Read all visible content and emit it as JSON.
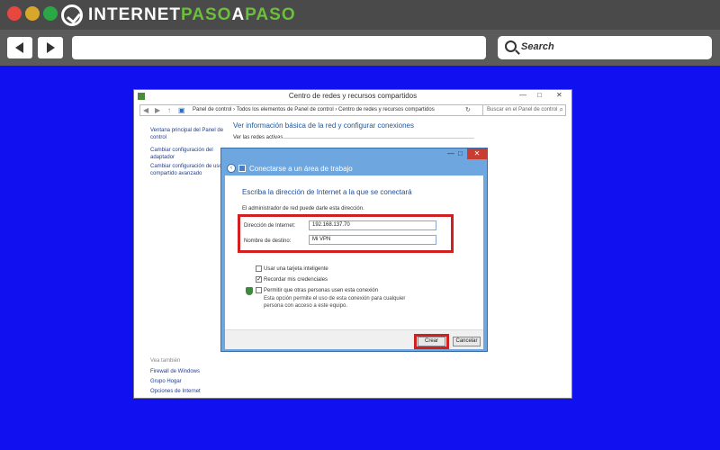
{
  "brand": {
    "name_part1": "INTERNET",
    "name_part2": "PASO",
    "name_part3": "A",
    "name_part4": "PASO"
  },
  "browser": {
    "search_placeholder": "Search"
  },
  "window": {
    "title": "Centro de redes y recursos compartidos",
    "controls": {
      "minimize": "—",
      "maximize": "□",
      "close": "✕"
    },
    "address": {
      "path": "Panel de control  ›  Todos los elementos de Panel de control  ›  Centro de redes y recursos compartidos",
      "search_placeholder": "Buscar en el Panel de control"
    },
    "sidebar": {
      "items": [
        {
          "label": "Ventana principal del Panel de control"
        },
        {
          "label": "Cambiar configuración del adaptador"
        },
        {
          "label": "Cambiar configuración de uso compartido avanzado"
        }
      ],
      "see_also": "Vea también",
      "see_also_items": [
        {
          "label": "Firewall de Windows"
        },
        {
          "label": "Grupo Hogar"
        },
        {
          "label": "Opciones de Internet"
        }
      ]
    },
    "main": {
      "heading": "Ver información básica de la red y configurar conexiones",
      "active_networks": "Ver las redes activas"
    }
  },
  "dialog": {
    "title": "Conectarse a un área de trabajo",
    "instruction": "Escriba la dirección de Internet a la que se conectará",
    "admin_note": "El administrador de red puede darle esta dirección.",
    "internet_address_label": "Dirección de Internet:",
    "internet_address_value": "192.168.137.70",
    "destination_name_label": "Nombre de destino:",
    "destination_name_value": "Mi VPN",
    "options": [
      {
        "label": "Usar una tarjeta inteligente",
        "checked": false
      },
      {
        "label": "Recordar mis credenciales",
        "checked": true
      },
      {
        "label": "Permitir que otras personas usen esta conexión",
        "checked": false
      }
    ],
    "allow_help": "Esta opción permite el uso de esta conexión para cualquier persona con acceso a este equipo.",
    "create_button": "Crear",
    "cancel_button": "Cancelar",
    "highlight_color": "#d21f1f"
  }
}
